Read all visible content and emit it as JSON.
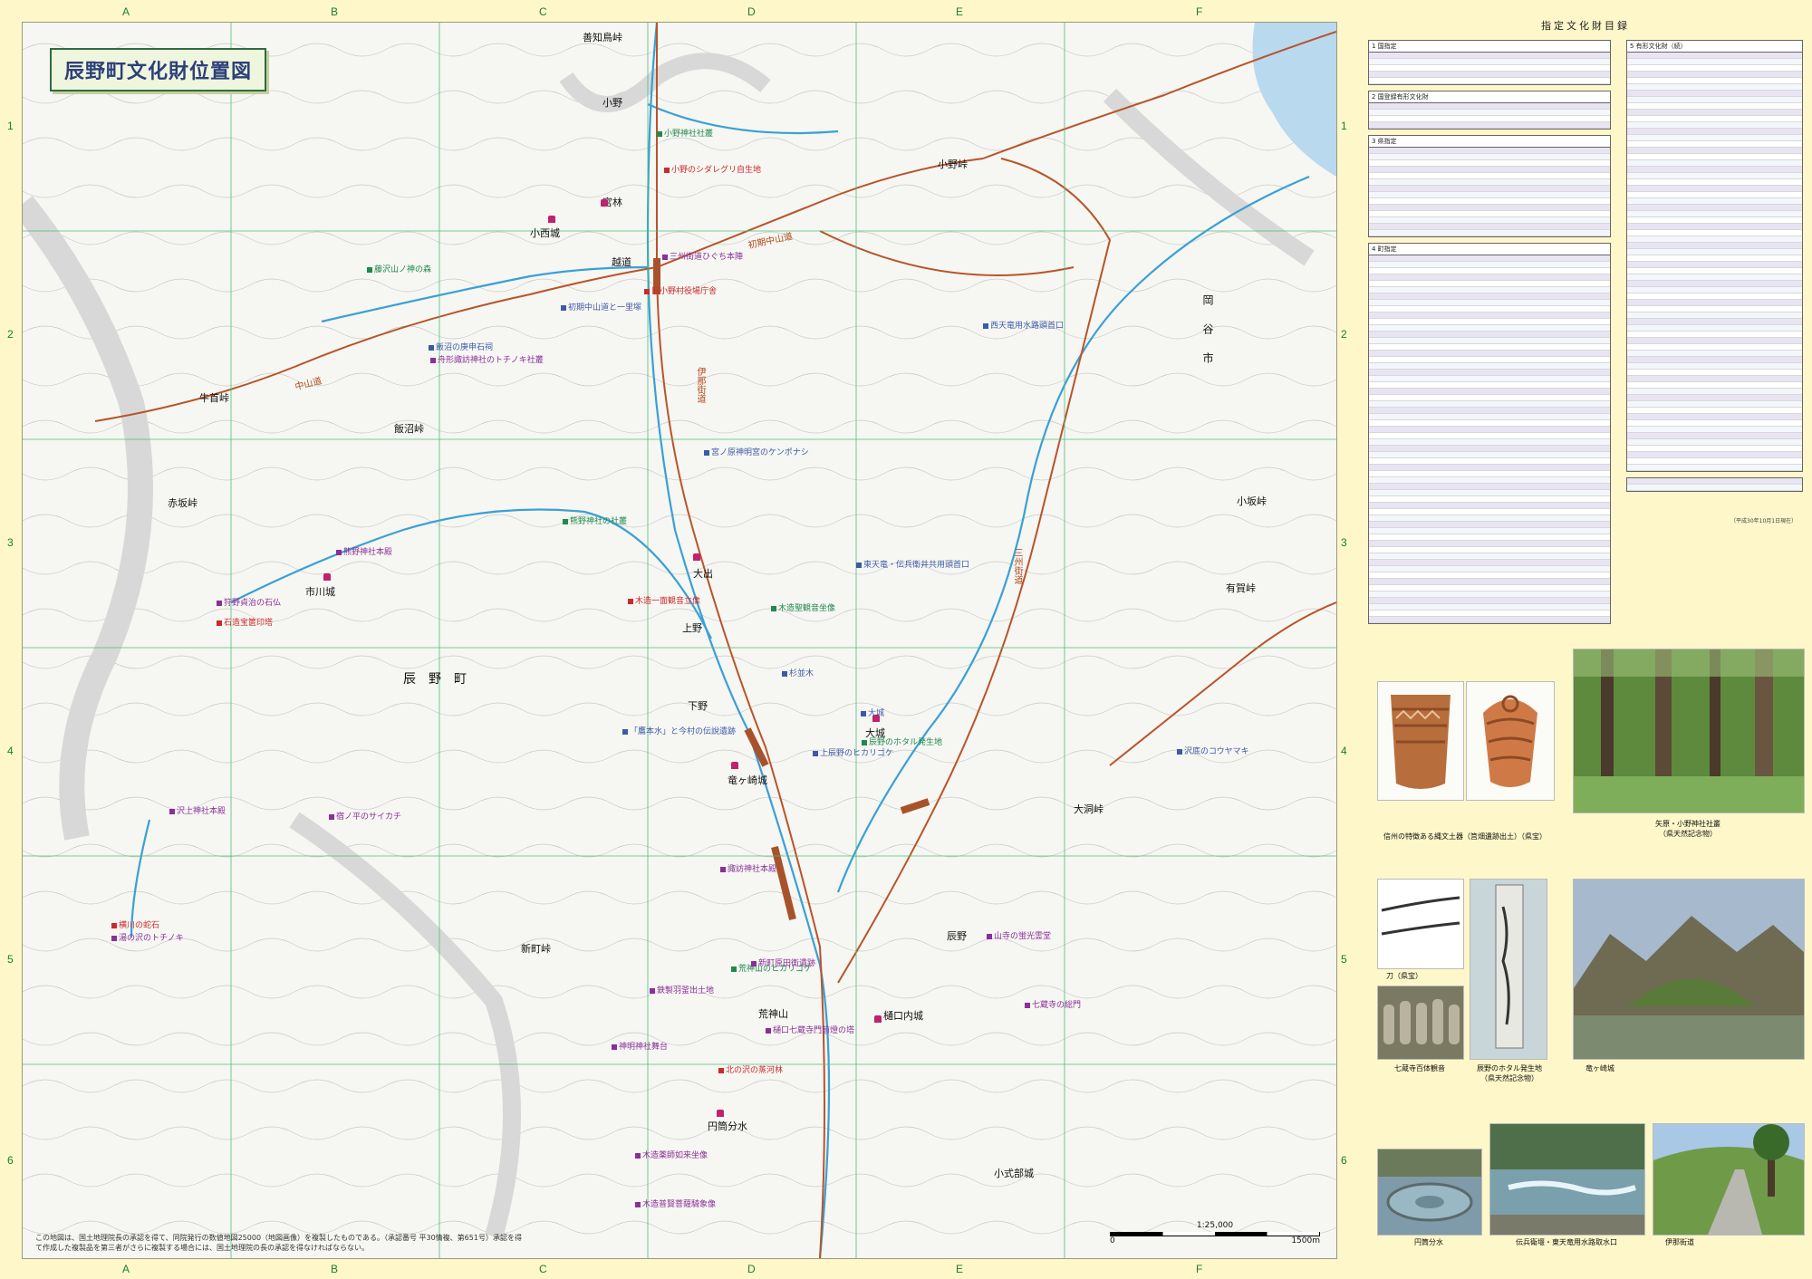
{
  "map": {
    "title": "辰野町文化財位置図",
    "cols": [
      "A",
      "B",
      "C",
      "D",
      "E",
      "F"
    ],
    "rows": [
      "1",
      "2",
      "3",
      "4",
      "5",
      "6"
    ],
    "places": [
      "善知鳥峠",
      "小野",
      "小西城",
      "宮林",
      "越道",
      "飯沼峠",
      "牛首峠",
      "赤坂峠",
      "市川城",
      "辰野町",
      "大出",
      "上野",
      "下野",
      "大城",
      "竜ヶ崎城",
      "新町峠",
      "辰野",
      "荒神山",
      "樋口内城",
      "円筒分水",
      "小式部城",
      "岡谷市",
      "小坂峠",
      "有賀峠",
      "大洞峠",
      "小野峠"
    ],
    "roads": [
      "初期中山道",
      "伊那街道",
      "三州街道",
      "中山道"
    ],
    "markers": [
      {
        "t": "小野神社社叢",
        "c": "nat"
      },
      {
        "t": "小野のシダレグリ自生地",
        "c": "red"
      },
      {
        "t": "初期中山道と一里塚",
        "c": "pref"
      },
      {
        "t": "旧小野村役場庁舎",
        "c": "red"
      },
      {
        "t": "三州街道ひぐち本陣",
        "c": "town"
      },
      {
        "t": "藤沢山ノ神の森",
        "c": "nat"
      },
      {
        "t": "飯沼の庚申石祠",
        "c": "pref"
      },
      {
        "t": "舟形諏訪神社のトチノキ社叢",
        "c": "town"
      },
      {
        "t": "宮ノ原神明宮のケンポナシ",
        "c": "pref"
      },
      {
        "t": "熊野神社の社叢",
        "c": "nat"
      },
      {
        "t": "熊野神社本殿",
        "c": "town"
      },
      {
        "t": "狩野貞治の石仏",
        "c": "town"
      },
      {
        "t": "石造宝篋印塔",
        "c": "red"
      },
      {
        "t": "木造一面観音立像",
        "c": "red"
      },
      {
        "t": "木造聖観音坐像",
        "c": "nat"
      },
      {
        "t": "杉並木",
        "c": "pref"
      },
      {
        "t": "「鷹本水」と今村の伝說遺跡",
        "c": "pref"
      },
      {
        "t": "上辰野のヒカリゴケ",
        "c": "pref"
      },
      {
        "t": "辰野のホタル発生地",
        "c": "nat"
      },
      {
        "t": "荒神山のヒカリゴケ",
        "c": "nat"
      },
      {
        "t": "宿ノ平のサイカチ",
        "c": "town"
      },
      {
        "t": "沢上神社本殿",
        "c": "town"
      },
      {
        "t": "横川の蛇石",
        "c": "red"
      },
      {
        "t": "湯の沢のトチノキ",
        "c": "town"
      },
      {
        "t": "諏訪神社本殿",
        "c": "town"
      },
      {
        "t": "新町原田衛遺跡",
        "c": "town"
      },
      {
        "t": "鉄製羽釜出土地",
        "c": "town"
      },
      {
        "t": "神明神社舞台",
        "c": "town"
      },
      {
        "t": "北の沢の蒸河林",
        "c": "red"
      },
      {
        "t": "樋口七蔵寺門前燈の塔",
        "c": "town"
      },
      {
        "t": "山寺の蛍光霊堂",
        "c": "town"
      },
      {
        "t": "七蔵寺の総門",
        "c": "town"
      },
      {
        "t": "木造薬師如来坐像",
        "c": "town"
      },
      {
        "t": "木造普賢菩薩騎象像",
        "c": "town"
      },
      {
        "t": "沢底のコウヤマキ",
        "c": "pref"
      },
      {
        "t": "大城",
        "c": "pref"
      },
      {
        "t": "西天竜用水路頭首口",
        "c": "pref"
      },
      {
        "t": "東天竜・伝兵衛井共用頭首口",
        "c": "pref"
      }
    ],
    "note": "この地図は、国土地理院長の承認を得て、同院発行の数値地図25000（地図画像）を複製したものである。（承認番号 平30情複、第651号）承認を得て作成した複製品を第三者がさらに複製する場合には、国土地理院の長の承認を得なければならない。",
    "scale": "1:25,000",
    "scale_marks": [
      "0",
      "",
      "1500m"
    ]
  },
  "panel": {
    "title": "指定文化財目録",
    "left_tables": [
      {
        "heading": "1 国指定",
        "rows": 5
      },
      {
        "heading": "2 国登録有形文化財",
        "rows": 4
      },
      {
        "heading": "3 県指定",
        "rows": 14
      },
      {
        "heading": "4 町指定",
        "rows": 58
      }
    ],
    "right_tables": [
      {
        "heading": "5 有形文化財（続）",
        "rows": 66
      },
      {
        "heading": "",
        "rows": 2
      }
    ],
    "footnote": "（平成30年10月1日現在）"
  },
  "photos": [
    {
      "caption": "信州の特徴ある縄文土器（筥畑遺跡出土）（県宝）"
    },
    {
      "caption": "矢原・小野神社社叢\n（県天然記念物）"
    },
    {
      "caption": "刀（県宝）"
    },
    {
      "caption": "七蔵寺百体観音"
    },
    {
      "caption": "辰野のホタル発生地\n（県天然記念物）"
    },
    {
      "caption": "竜ヶ崎城"
    },
    {
      "caption": "円筒分水"
    },
    {
      "caption": "伝兵衛堰・東天竜用水路取水口"
    },
    {
      "caption": "伊那街道"
    }
  ],
  "colors": {
    "page": "#fdf7c9",
    "map": "#f6f6f2",
    "river": "#3aa0d6",
    "road": "#b8542a",
    "grid": "#4bbf78",
    "contour": "#c8c8c8"
  }
}
